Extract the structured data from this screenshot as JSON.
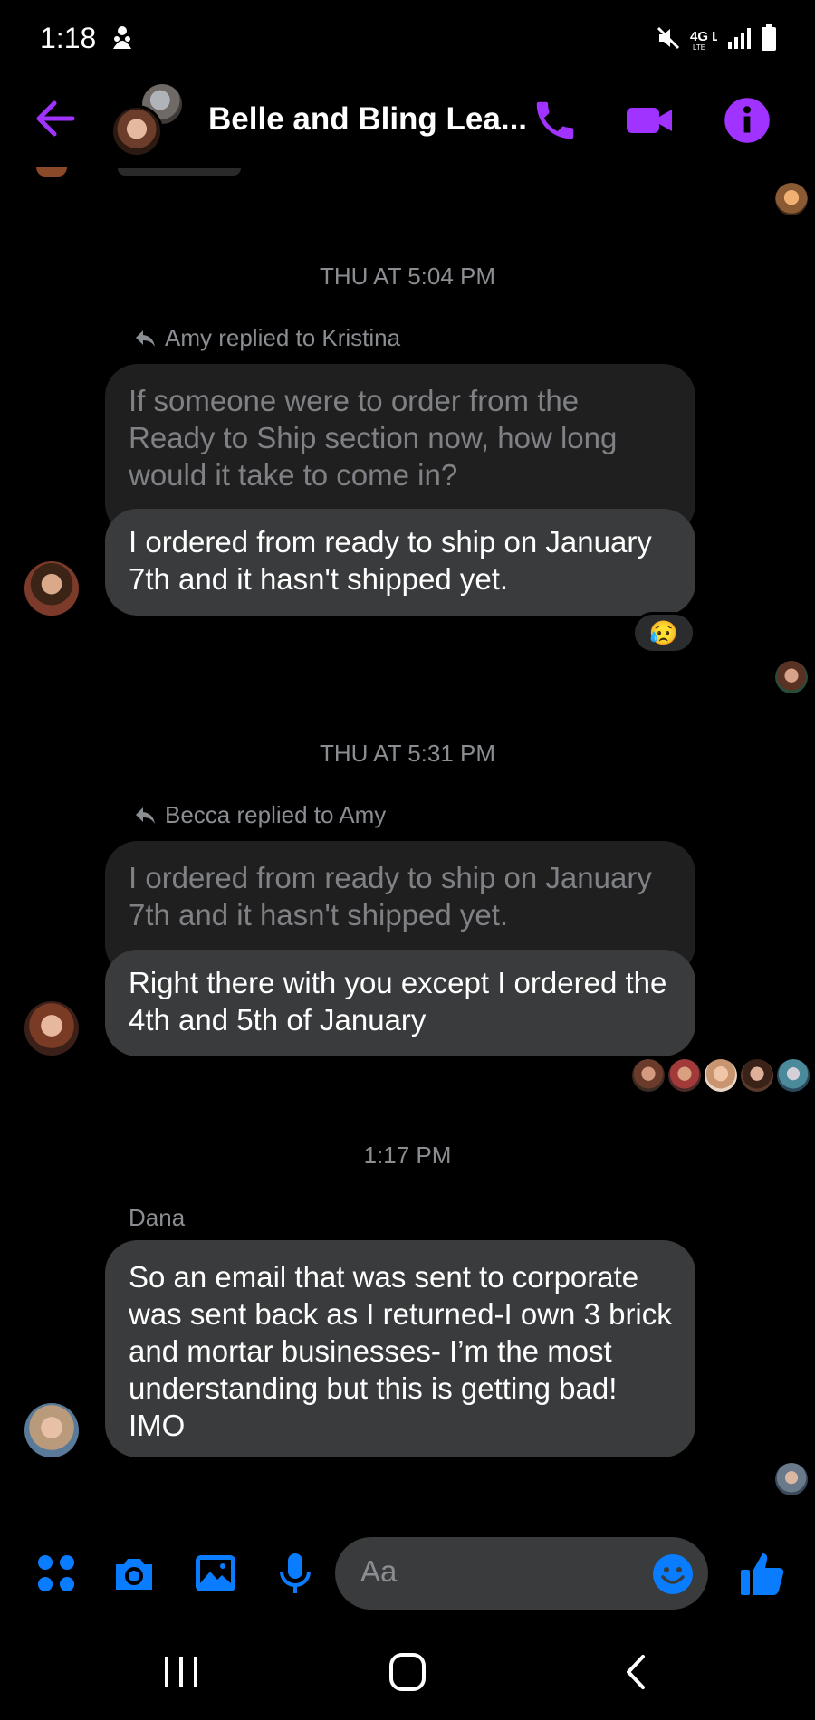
{
  "status_bar": {
    "time": "1:18",
    "network": "4G LTE"
  },
  "header": {
    "title": "Belle and Bling Lea...",
    "accent_color": "#a033ff"
  },
  "messages": [
    {
      "timestamp": "THU AT 5:04 PM",
      "reply_note": "Amy replied to Kristina",
      "quoted_text": "If someone were to order from the Ready to Ship section now, how long would it take to come in?",
      "text": "I ordered from ready to ship on January 7th and it hasn't shipped yet.",
      "reaction": "😥"
    },
    {
      "timestamp": "THU AT 5:31 PM",
      "reply_note": "Becca replied to Amy",
      "quoted_text": "I ordered from ready to ship on January 7th and it hasn't shipped yet.",
      "text": "Right there with you except I ordered the 4th and 5th of January"
    },
    {
      "timestamp": "1:17 PM",
      "sender": "Dana",
      "text": "So an email that was sent to corporate was sent back as I returned-I own 3 brick and mortar businesses- I’m the most understanding but this is getting bad! IMO"
    }
  ],
  "composer": {
    "placeholder": "Aa",
    "icon_color": "#0a7cff"
  }
}
